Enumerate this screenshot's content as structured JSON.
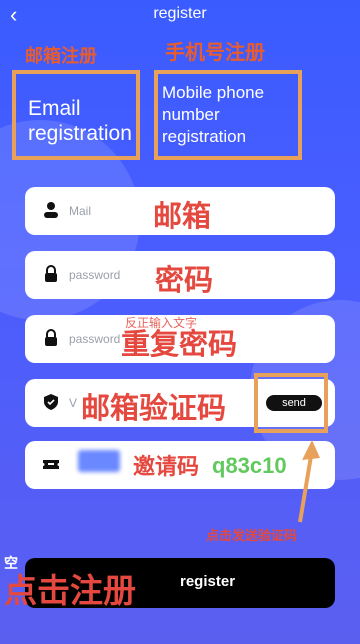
{
  "header": {
    "title": "register",
    "back_icon": "chevron-left-icon"
  },
  "tabs": {
    "email": {
      "label": "Email registration",
      "annotation": "邮箱注册"
    },
    "phone": {
      "label": "Mobile phone number registration",
      "annotation": "手机号注册"
    }
  },
  "fields": {
    "mail": {
      "placeholder": "Mail",
      "annotation": "邮箱",
      "icon": "user-icon"
    },
    "password": {
      "placeholder": "password",
      "annotation": "密码",
      "icon": "lock-icon"
    },
    "confirm_password": {
      "placeholder": "password",
      "annotation": "重复密码",
      "icon": "lock-icon",
      "note": "反正输入文字"
    },
    "verify_code": {
      "placeholder": "V",
      "annotation": "邮箱验证码",
      "icon": "shield-icon",
      "send_label": "send"
    },
    "invite_code": {
      "annotation": "邀请码",
      "code": "q83c10",
      "icon": "ticket-icon"
    }
  },
  "annotations": {
    "send_hint": "点击发送验证码",
    "register_hint": "点击注册",
    "register_small": "空"
  },
  "register_button": {
    "label": "register"
  },
  "colors": {
    "background": "#3a5cff",
    "highlight": "#e8a15a",
    "annotation_red": "#e4483f",
    "code_green": "#62c95f"
  }
}
